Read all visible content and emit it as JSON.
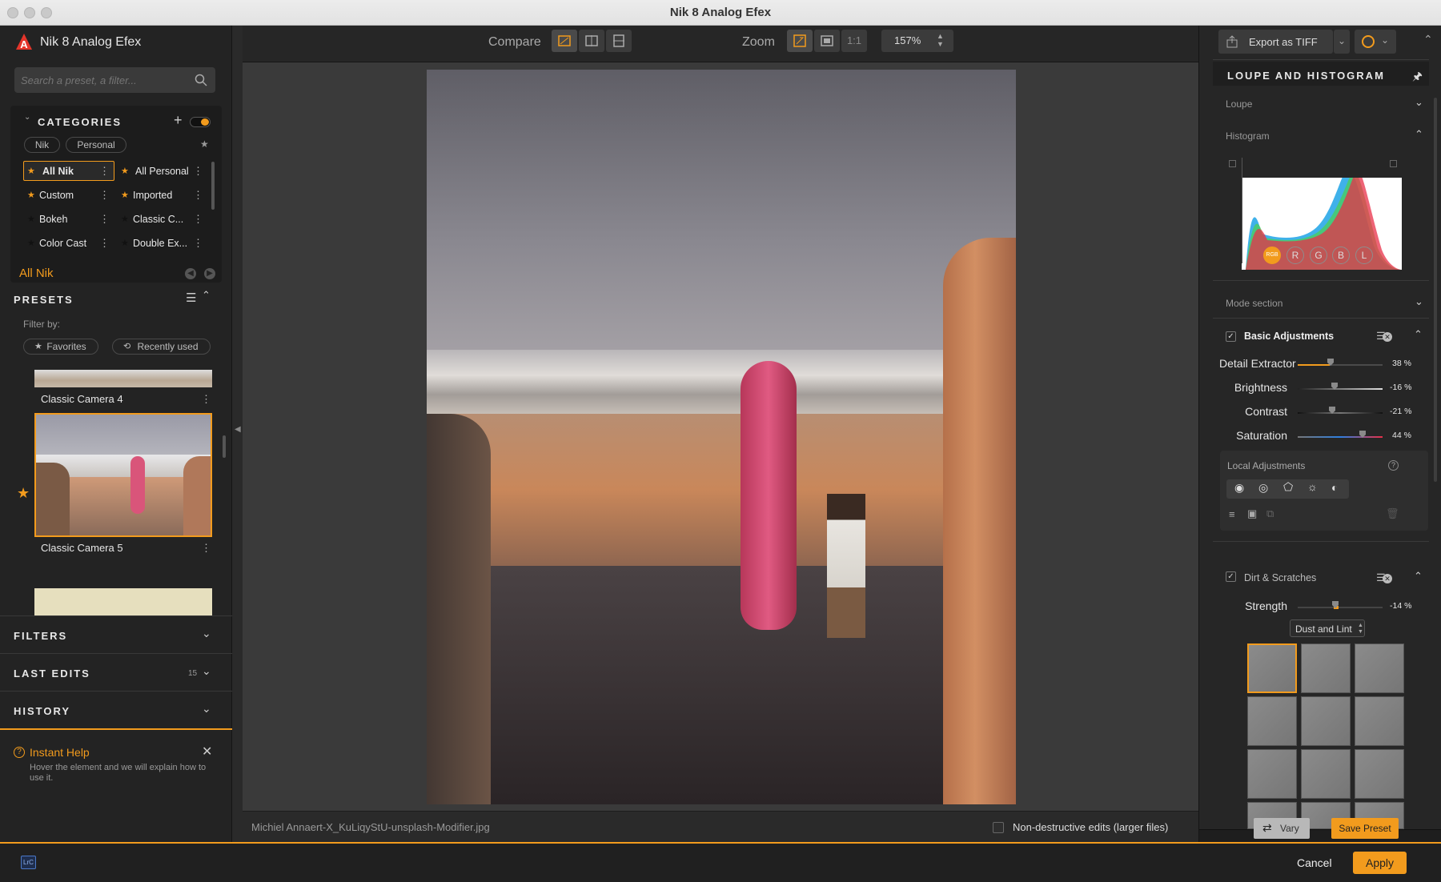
{
  "window": {
    "title": "Nik 8 Analog Efex"
  },
  "app": {
    "name": "Nik 8 Analog Efex"
  },
  "search": {
    "placeholder": "Search a preset, a filter..."
  },
  "categories": {
    "title": "CATEGORIES",
    "tags": [
      "Nik",
      "Personal"
    ],
    "items": [
      {
        "label": "All Nik"
      },
      {
        "label": "All Personal"
      },
      {
        "label": "Custom"
      },
      {
        "label": "Imported"
      },
      {
        "label": "Bokeh"
      },
      {
        "label": "Classic C..."
      },
      {
        "label": "Color Cast"
      },
      {
        "label": "Double Ex..."
      }
    ]
  },
  "selected_category": "All Nik",
  "presets": {
    "title": "PRESETS",
    "filter_by": "Filter by:",
    "filter_favorites": "Favorites",
    "filter_recent": "Recently used",
    "items": [
      {
        "label": "Classic Camera 4"
      },
      {
        "label": "Classic Camera 5"
      }
    ]
  },
  "sections": {
    "filters": "FILTERS",
    "last_edits": "LAST EDITS",
    "last_edits_count": "15",
    "history": "HISTORY"
  },
  "help": {
    "title": "Instant Help",
    "text": "Hover the element and we will explain how to use it."
  },
  "toolbar": {
    "compare": "Compare",
    "zoom": "Zoom",
    "one_to_one": "1:1",
    "zoom_value": "157%"
  },
  "status": {
    "filename": "Michiel Annaert-X_KuLiqyStU-unsplash-Modifier.jpg",
    "nondestructive": "Non-destructive edits (larger files)"
  },
  "right": {
    "export": "Export as TIFF",
    "loupe_title": "LOUPE AND HISTOGRAM",
    "loupe": "Loupe",
    "histogram": "Histogram",
    "channels": [
      "RGB",
      "R",
      "G",
      "B",
      "L"
    ],
    "mode_section": "Mode section",
    "basic": {
      "title": "Basic Adjustments",
      "sliders": [
        {
          "label": "Detail Extractor",
          "value": "38 %",
          "pct": 38
        },
        {
          "label": "Brightness",
          "value": "-16 %",
          "pct": -16
        },
        {
          "label": "Contrast",
          "value": "-21 %",
          "pct": -21
        },
        {
          "label": "Saturation",
          "value": "44 %",
          "pct": 44
        }
      ]
    },
    "local": "Local Adjustments",
    "dirt": {
      "title": "Dirt & Scratches",
      "strength_label": "Strength",
      "strength_value": "-14 %",
      "strength_pct": -14,
      "type": "Dust and Lint"
    },
    "vary": "Vary",
    "save_preset": "Save Preset"
  },
  "bottom": {
    "cancel": "Cancel",
    "apply": "Apply",
    "lrc": "LrC"
  },
  "colors": {
    "accent": "#f29b1d",
    "panel": "#232323",
    "canvas": "#3a3a3a"
  }
}
